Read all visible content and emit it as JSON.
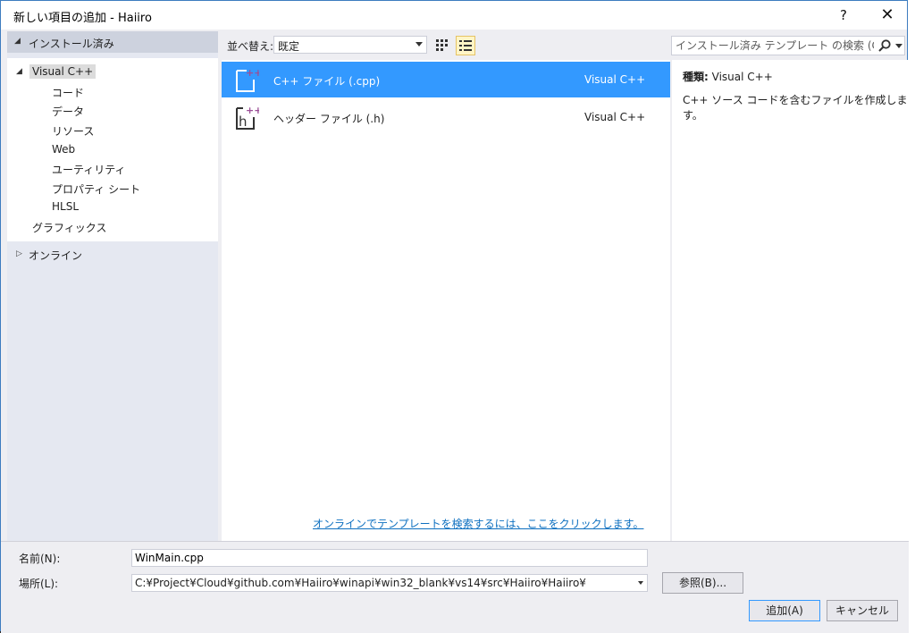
{
  "window": {
    "title": "新しい項目の追加 - Haiiro",
    "help_label": "?",
    "close_label": "✕"
  },
  "left_panel": {
    "installed_header": "インストール済み",
    "tree": {
      "root": "Visual C++",
      "children": [
        "コード",
        "データ",
        "リソース",
        "Web",
        "ユーティリティ",
        "プロパティ シート",
        "HLSL"
      ],
      "sibling": "グラフィックス"
    },
    "online": "オンライン"
  },
  "toolbar": {
    "sort_label": "並べ替え:",
    "sort_value": "既定",
    "search_placeholder": "インストール済み テンプレート の検索 (Ctrl+E"
  },
  "templates": [
    {
      "name": "C++ ファイル (.cpp)",
      "lang": "Visual C++",
      "icon": "cpp-file-icon",
      "selected": true
    },
    {
      "name": "ヘッダー ファイル (.h)",
      "lang": "Visual C++",
      "icon": "header-file-icon",
      "selected": false
    }
  ],
  "online_link": "オンラインでテンプレートを検索するには、ここをクリックします。",
  "details": {
    "type_label": "種類:",
    "type_value": "Visual C++",
    "description": "C++ ソース コードを含むファイルを作成します。"
  },
  "form": {
    "name_label": "名前(N):",
    "name_value": "WinMain.cpp",
    "location_label": "場所(L):",
    "location_value": "C:¥Project¥Cloud¥github.com¥Haiiro¥winapi¥win32_blank¥vs14¥src¥Haiiro¥Haiiro¥",
    "browse_button": "参照(B)...",
    "add_button": "追加(A)",
    "cancel_button": "キャンセル"
  },
  "colors": {
    "accent": "#3399ff",
    "link": "#0e70c0",
    "template_icon_plus": "#9b4f96"
  }
}
